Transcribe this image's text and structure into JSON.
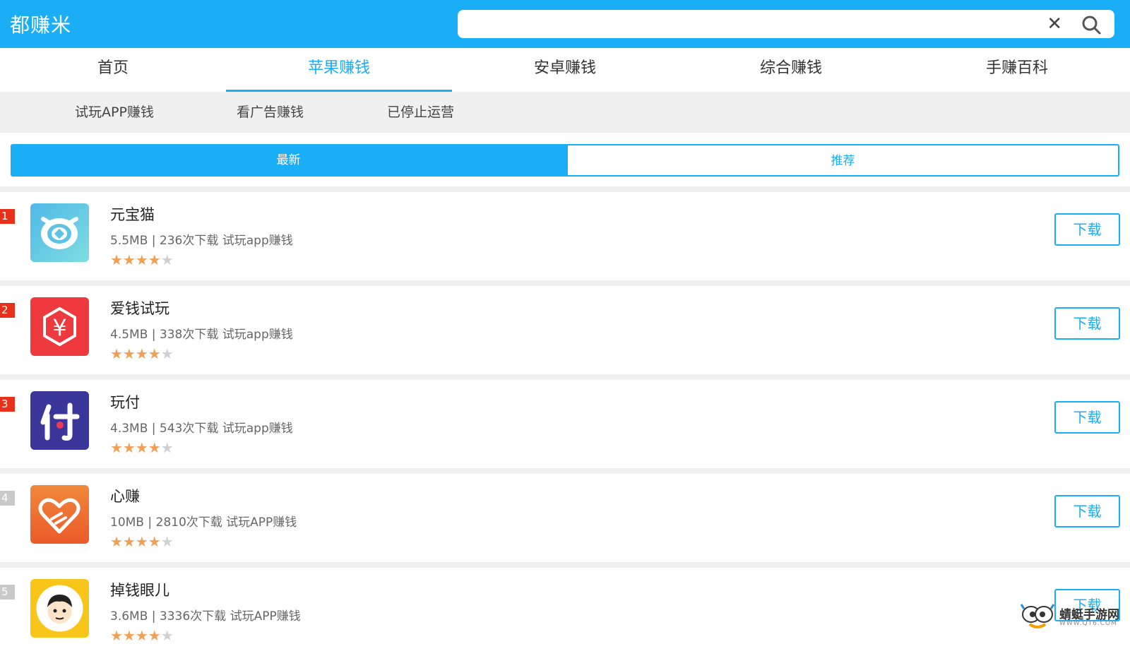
{
  "header": {
    "logo": "都赚米",
    "search_placeholder": ""
  },
  "nav": {
    "tabs": [
      {
        "label": "首页",
        "active": false
      },
      {
        "label": "苹果赚钱",
        "active": true
      },
      {
        "label": "安卓赚钱",
        "active": false
      },
      {
        "label": "综合赚钱",
        "active": false
      },
      {
        "label": "手赚百科",
        "active": false
      }
    ]
  },
  "subnav": {
    "items": [
      "试玩APP赚钱",
      "看广告赚钱",
      "已停止运营"
    ]
  },
  "toggle": {
    "left": "最新",
    "right": "推荐"
  },
  "apps": [
    {
      "rank": "1",
      "name": "元宝猫",
      "meta": "5.5MB | 236次下载  试玩app赚钱",
      "rating": 4.5,
      "download": "下载"
    },
    {
      "rank": "2",
      "name": "爱钱试玩",
      "meta": "4.5MB | 338次下载  试玩app赚钱",
      "rating": 4.5,
      "download": "下载"
    },
    {
      "rank": "3",
      "name": "玩付",
      "meta": "4.3MB | 543次下载  试玩app赚钱",
      "rating": 4.5,
      "download": "下载"
    },
    {
      "rank": "4",
      "name": "心赚",
      "meta": "10MB | 2810次下载  试玩APP赚钱",
      "rating": 4.5,
      "download": "下载"
    },
    {
      "rank": "5",
      "name": "掉钱眼儿",
      "meta": "3.6MB | 3336次下载  试玩APP赚钱",
      "rating": 4.5,
      "download": "下载"
    }
  ],
  "watermark": {
    "title": "蜻蜓手游网",
    "sub": "WWW.QT6.COM"
  },
  "colors": {
    "accent": "#1aaef7",
    "rank_top": "#e8301a",
    "star": "#f0a052"
  }
}
